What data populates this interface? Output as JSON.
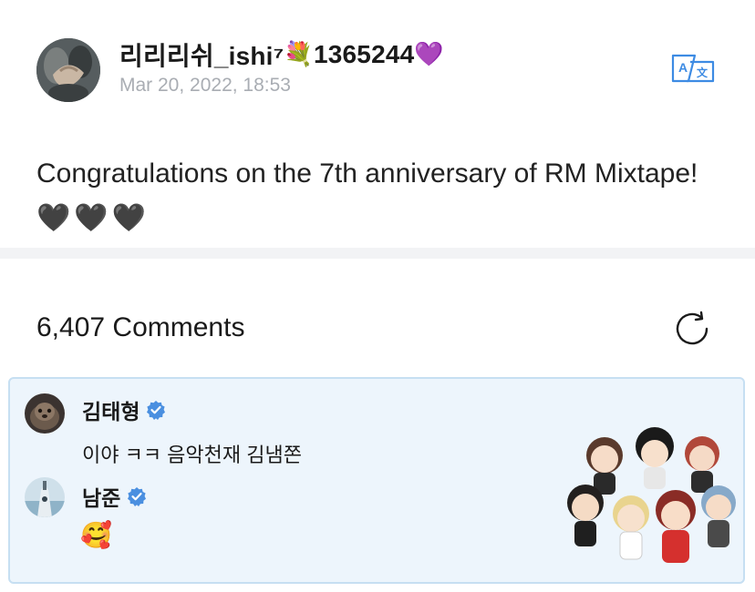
{
  "post": {
    "author": {
      "name": "리리리쉬_ishi⁷",
      "flower_emoji": "💐",
      "number": "1365244",
      "heart_emoji": "💜"
    },
    "date": "Mar 20, 2022, 18:53",
    "body_text": "Congratulations on the 7th anniversary of RM Mixtape!",
    "body_hearts": "🖤🖤🖤",
    "translate_icon": "translate-icon"
  },
  "comments": {
    "count_label": "6,407 Comments",
    "refresh_icon": "refresh-icon",
    "highlighted": [
      {
        "name": "김태형",
        "verified": true,
        "text": "이야 ㅋㅋ 음악천재 김냄쫀"
      },
      {
        "name": "남준",
        "verified": true,
        "text": "🥰"
      }
    ],
    "sticker": "group-character-sticker"
  },
  "colors": {
    "highlight_bg": "#edf5fc",
    "highlight_border": "#c6dff2",
    "verified_blue": "#4a8fe0",
    "date_gray": "#a9adb3",
    "translate_blue": "#3d8be3"
  }
}
